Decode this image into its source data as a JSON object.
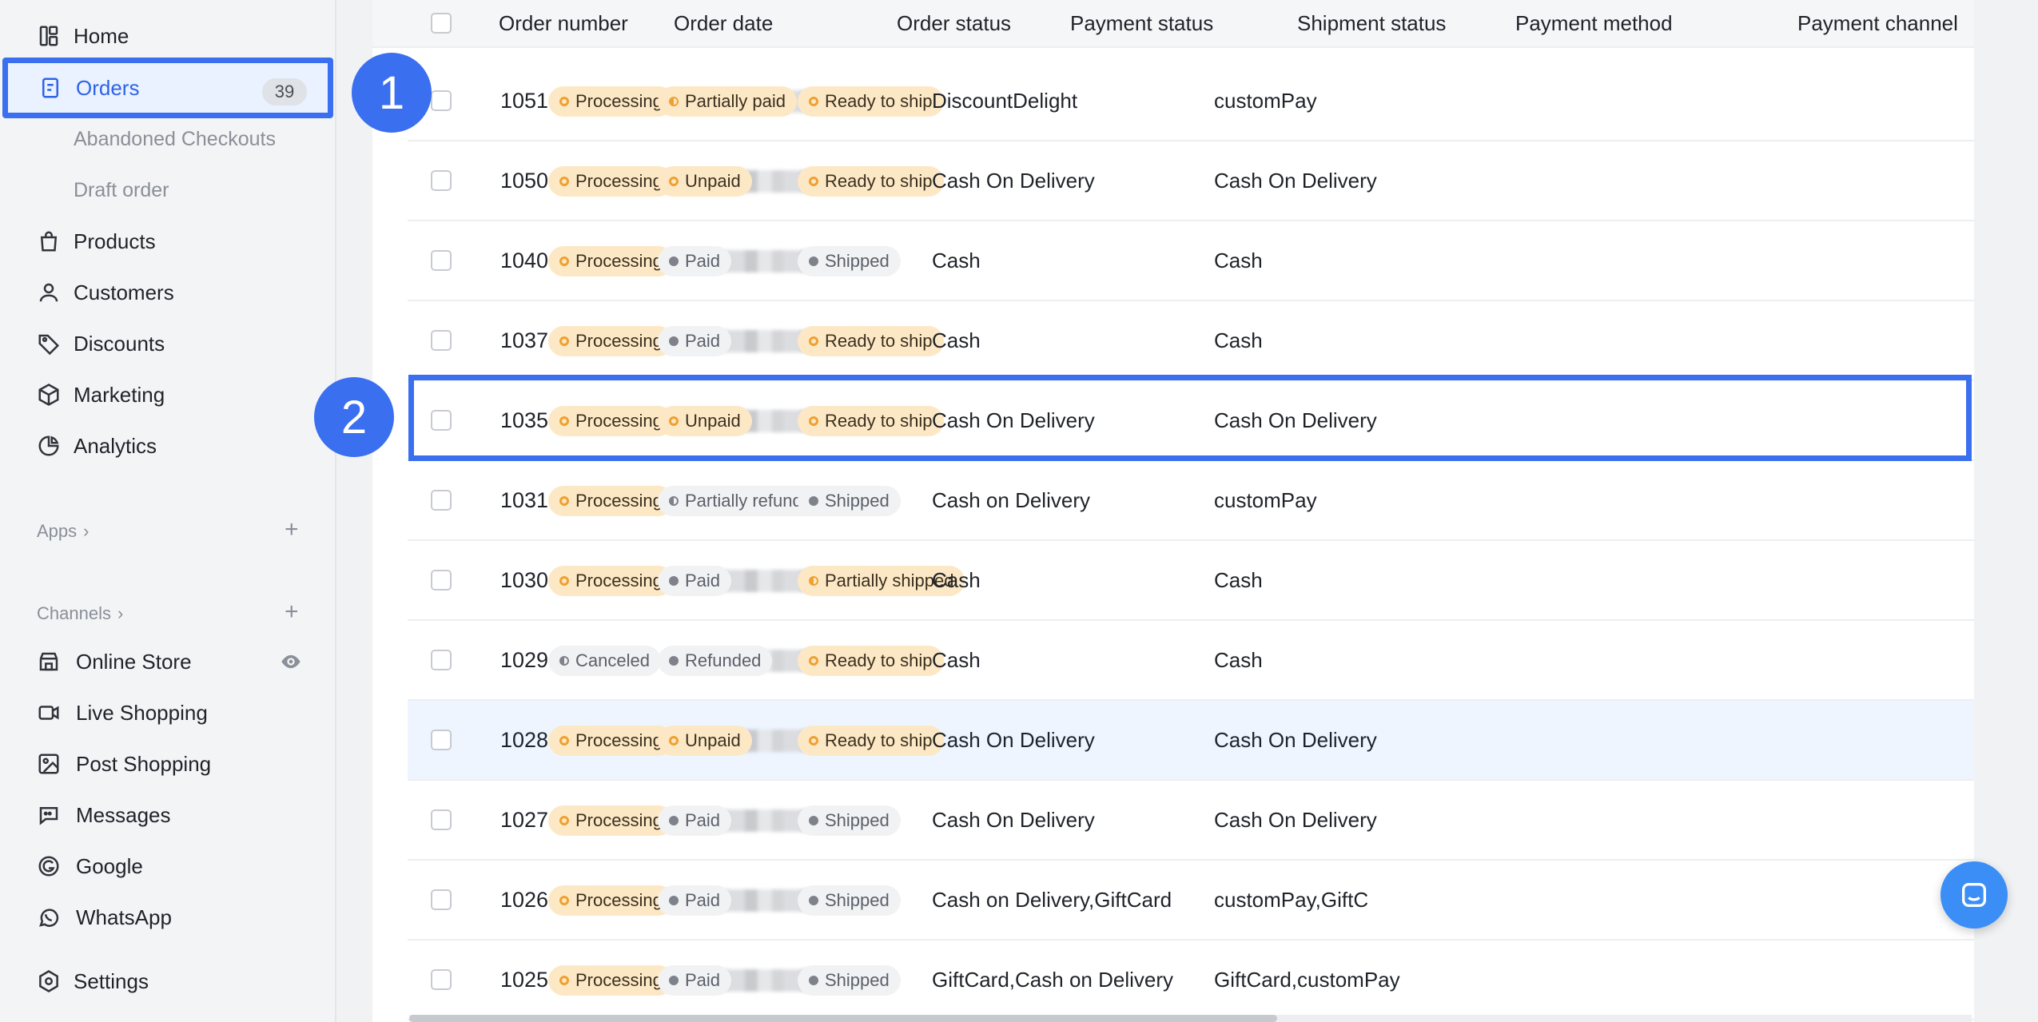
{
  "sidebar": {
    "items": [
      {
        "label": "Home",
        "icon": "home-icon"
      },
      {
        "label": "Orders",
        "icon": "orders-icon",
        "badge": "39"
      },
      {
        "label": "Abandoned Checkouts"
      },
      {
        "label": "Draft order"
      },
      {
        "label": "Products",
        "icon": "bag-icon"
      },
      {
        "label": "Customers",
        "icon": "user-icon"
      },
      {
        "label": "Discounts",
        "icon": "tag-icon"
      },
      {
        "label": "Marketing",
        "icon": "cube-icon"
      },
      {
        "label": "Analytics",
        "icon": "pie-chart-icon"
      }
    ],
    "apps_label": "Apps",
    "channels_label": "Channels",
    "channels": [
      {
        "label": "Online Store",
        "icon": "store-icon"
      },
      {
        "label": "Live Shopping",
        "icon": "video-icon"
      },
      {
        "label": "Post Shopping",
        "icon": "image-icon"
      },
      {
        "label": "Messages",
        "icon": "chat-icon"
      },
      {
        "label": "Google",
        "icon": "google-icon"
      },
      {
        "label": "WhatsApp",
        "icon": "whatsapp-icon"
      }
    ],
    "settings_label": "Settings"
  },
  "table": {
    "headers": [
      "Order number",
      "Order date",
      "Order status",
      "Payment status",
      "Shipment status",
      "Payment method",
      "Payment channel"
    ],
    "rows": [
      {
        "num": "1051",
        "order_status": "Processing",
        "payment_status": "Partially paid",
        "shipment_status": "Ready to ship",
        "payment_method": "DiscountDelight",
        "payment_channel": "customPay"
      },
      {
        "num": "1050",
        "order_status": "Processing",
        "payment_status": "Unpaid",
        "shipment_status": "Ready to ship",
        "payment_method": "Cash On Delivery",
        "payment_channel": "Cash On Delivery"
      },
      {
        "num": "1040",
        "order_status": "Processing",
        "payment_status": "Paid",
        "shipment_status": "Shipped",
        "payment_method": "Cash",
        "payment_channel": "Cash"
      },
      {
        "num": "1037",
        "order_status": "Processing",
        "payment_status": "Paid",
        "shipment_status": "Ready to ship",
        "payment_method": "Cash",
        "payment_channel": "Cash"
      },
      {
        "num": "1035",
        "order_status": "Processing",
        "payment_status": "Unpaid",
        "shipment_status": "Ready to ship",
        "payment_method": "Cash On Delivery",
        "payment_channel": "Cash On Delivery"
      },
      {
        "num": "1031",
        "order_status": "Processing",
        "payment_status": "Partially refunded",
        "shipment_status": "Shipped",
        "payment_method": "Cash on Delivery",
        "payment_channel": "customPay"
      },
      {
        "num": "1030",
        "order_status": "Processing",
        "payment_status": "Paid",
        "shipment_status": "Partially shipped",
        "payment_method": "Cash",
        "payment_channel": "Cash"
      },
      {
        "num": "1029",
        "order_status": "Canceled",
        "payment_status": "Refunded",
        "shipment_status": "Ready to ship",
        "payment_method": "Cash",
        "payment_channel": "Cash"
      },
      {
        "num": "1028",
        "order_status": "Processing",
        "payment_status": "Unpaid",
        "shipment_status": "Ready to ship",
        "payment_method": "Cash On Delivery",
        "payment_channel": "Cash On Delivery"
      },
      {
        "num": "1027",
        "order_status": "Processing",
        "payment_status": "Paid",
        "shipment_status": "Shipped",
        "payment_method": "Cash On Delivery",
        "payment_channel": "Cash On Delivery"
      },
      {
        "num": "1026",
        "order_status": "Processing",
        "payment_status": "Paid",
        "shipment_status": "Shipped",
        "payment_method": "Cash on Delivery,GiftCard",
        "payment_channel": "customPay,GiftC"
      },
      {
        "num": "1025",
        "order_status": "Processing",
        "payment_status": "Paid",
        "shipment_status": "Shipped",
        "payment_method": "GiftCard,Cash on Delivery",
        "payment_channel": "GiftCard,customPay"
      }
    ]
  },
  "callouts": [
    "1",
    "2"
  ],
  "colors": {
    "accent": "#3a6ff0",
    "warn_bg": "#fde8c6",
    "warn_dot": "#f0a030",
    "neutral_dot": "#7d828b"
  }
}
